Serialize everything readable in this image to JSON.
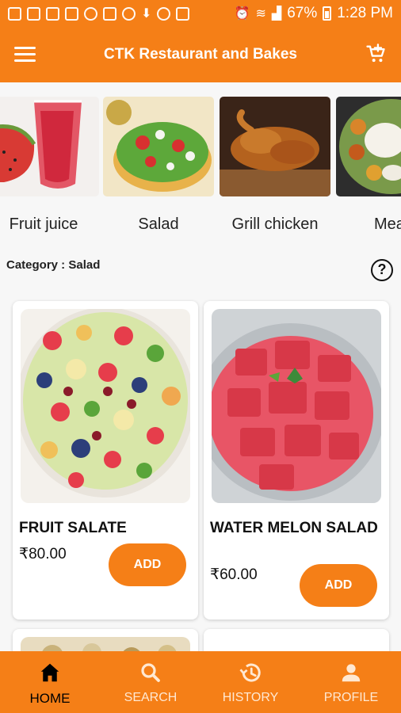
{
  "status_bar": {
    "battery": "67%",
    "time": "1:28 PM"
  },
  "app_bar": {
    "title": "CTK Restaurant and Bakes"
  },
  "categories": [
    {
      "label": "Fruit juice"
    },
    {
      "label": "Salad"
    },
    {
      "label": "Grill chicken"
    },
    {
      "label": "Mea"
    }
  ],
  "category_line": "Category : Salad",
  "help_glyph": "?",
  "products": [
    {
      "name": "FRUIT SALATE",
      "price": "₹80.00",
      "button": "ADD"
    },
    {
      "name": "WATER MELON SALAD",
      "price": "₹60.00",
      "button": "ADD"
    }
  ],
  "bottom_nav": [
    {
      "label": "HOME",
      "icon": "home-icon",
      "active": true
    },
    {
      "label": "SEARCH",
      "icon": "search-icon",
      "active": false
    },
    {
      "label": "HISTORY",
      "icon": "history-icon",
      "active": false
    },
    {
      "label": "PROFILE",
      "icon": "profile-icon",
      "active": false
    }
  ],
  "colors": {
    "brand": "#f57f17",
    "text": "#111111",
    "nav_inactive": "#ffe8d2"
  }
}
